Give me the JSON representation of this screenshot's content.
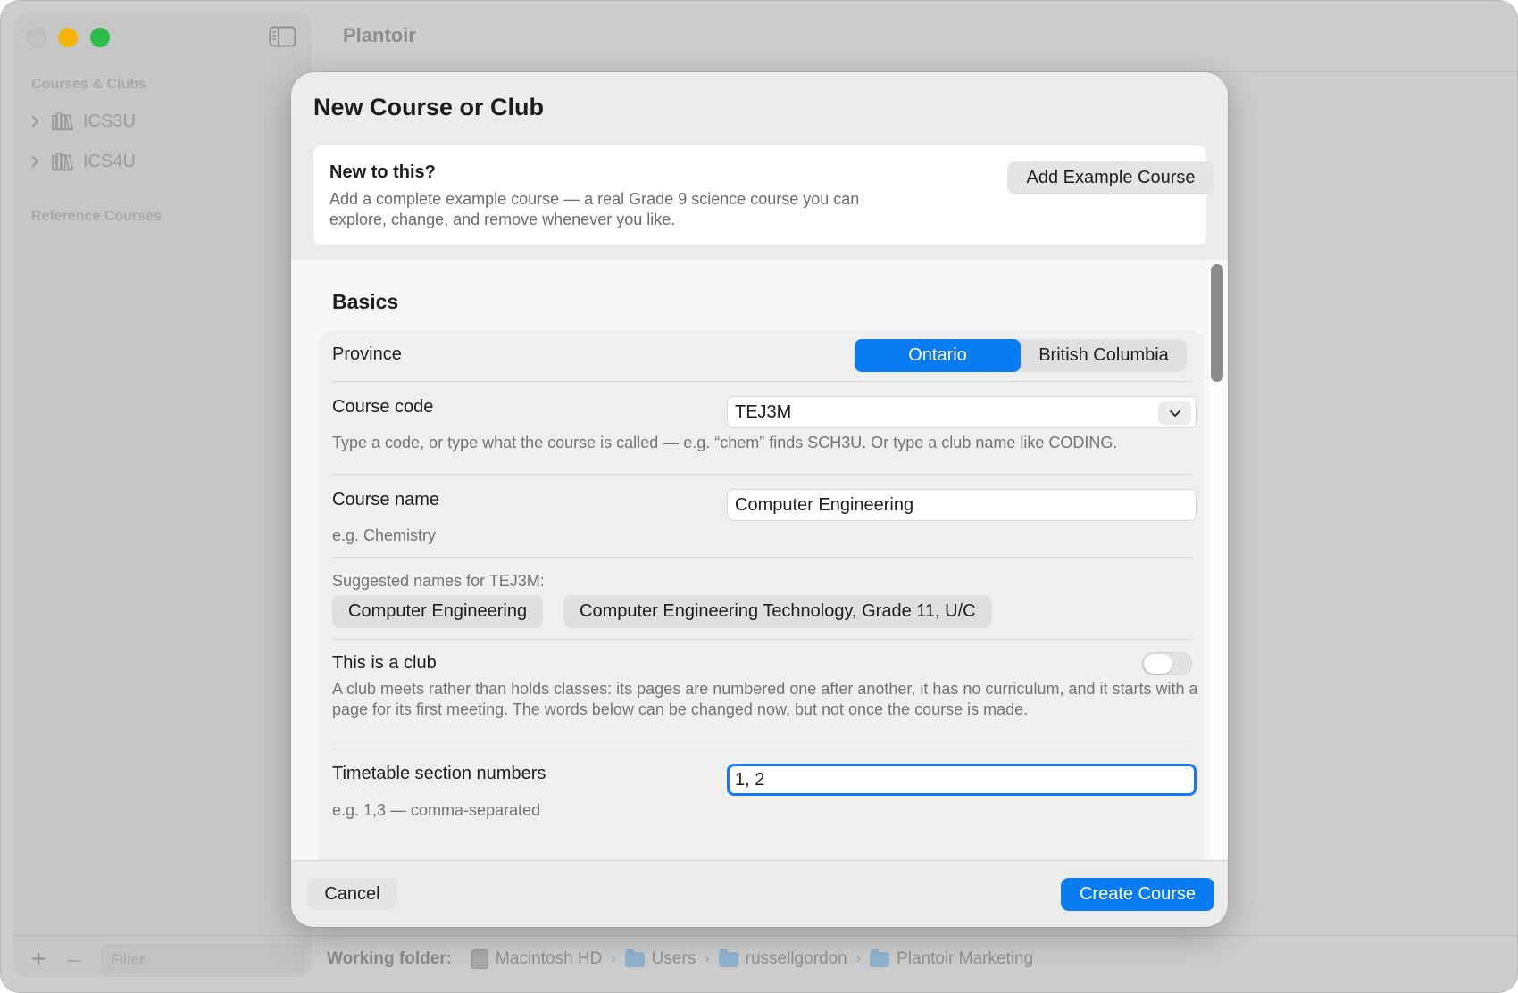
{
  "app": {
    "title": "Plantoir"
  },
  "sidebar": {
    "section_courses": "Courses & Clubs",
    "items": [
      {
        "label": "ICS3U"
      },
      {
        "label": "ICS4U"
      }
    ],
    "section_reference": "Reference Courses",
    "filter_placeholder": "Filter"
  },
  "status_bar": {
    "working_folder_label": "Working folder:",
    "path": [
      "Macintosh HD",
      "Users",
      "russellgordon",
      "Plantoir Marketing"
    ]
  },
  "sheet": {
    "title": "New Course or Club",
    "intro": {
      "heading": "New to this?",
      "text": "Add a complete example course — a real Grade 9 science course you can explore, change, and remove whenever you like.",
      "button": "Add Example Course"
    },
    "basics": {
      "title": "Basics",
      "province": {
        "label": "Province",
        "options": [
          "Ontario",
          "British Columbia"
        ],
        "selected": "Ontario"
      },
      "course_code": {
        "label": "Course code",
        "value": "TEJ3M",
        "help": "Type a code, or type what the course is called — e.g. “chem” finds SCH3U. Or type a club name like CODING."
      },
      "course_name": {
        "label": "Course name",
        "value": "Computer Engineering",
        "help": "e.g. Chemistry"
      },
      "suggestions": {
        "label": "Suggested names for TEJ3M:",
        "items": [
          "Computer Engineering",
          "Computer Engineering Technology, Grade 11, U/C"
        ]
      },
      "club": {
        "label": "This is a club",
        "on": false,
        "help": "A club meets rather than holds classes: its pages are numbered one after another, it has no curriculum, and it starts with a page for its first meeting. The words below can be changed now, but not once the course is made."
      },
      "sections": {
        "label": "Timetable section numbers",
        "value": "1, 2",
        "help": "e.g. 1,3 — comma-separated"
      }
    },
    "footer": {
      "cancel": "Cancel",
      "create": "Create Course"
    }
  },
  "colors": {
    "accent": "#0a7cf2",
    "traffic_min": "#f4b40a",
    "traffic_max": "#2bbd45"
  }
}
